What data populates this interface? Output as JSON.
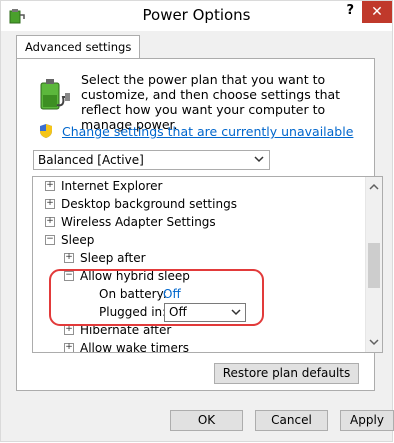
{
  "window": {
    "title": "Power Options",
    "help_label": "?",
    "close_label": "✕"
  },
  "tabs": [
    {
      "label": "Advanced settings"
    }
  ],
  "description": "Select the power plan that you want to customize, and then choose settings that reflect how you want your computer to manage power.",
  "change_link": "Change settings that are currently unavailable",
  "plan_dropdown": {
    "value": "Balanced [Active]"
  },
  "tree": {
    "items": [
      {
        "label": "Internet Explorer",
        "expander": "+"
      },
      {
        "label": "Desktop background settings",
        "expander": "+"
      },
      {
        "label": "Wireless Adapter Settings",
        "expander": "+"
      },
      {
        "label": "Sleep",
        "expander": "−"
      },
      {
        "label": "Sleep after",
        "expander": "+"
      },
      {
        "label": "Allow hybrid sleep",
        "expander": "−"
      },
      {
        "label": "Hibernate after",
        "expander": "+"
      },
      {
        "label": "Allow wake timers",
        "expander": "+"
      }
    ],
    "on_battery_label": "On battery:",
    "on_battery_value": "Off",
    "plugged_in_label": "Plugged in:",
    "plugged_in_value": "Off"
  },
  "buttons": {
    "restore": "Restore plan defaults",
    "ok": "OK",
    "cancel": "Cancel",
    "apply": "Apply"
  },
  "colors": {
    "link": "#0066cc",
    "highlight": "#e23a3a",
    "close": "#c0392b"
  }
}
